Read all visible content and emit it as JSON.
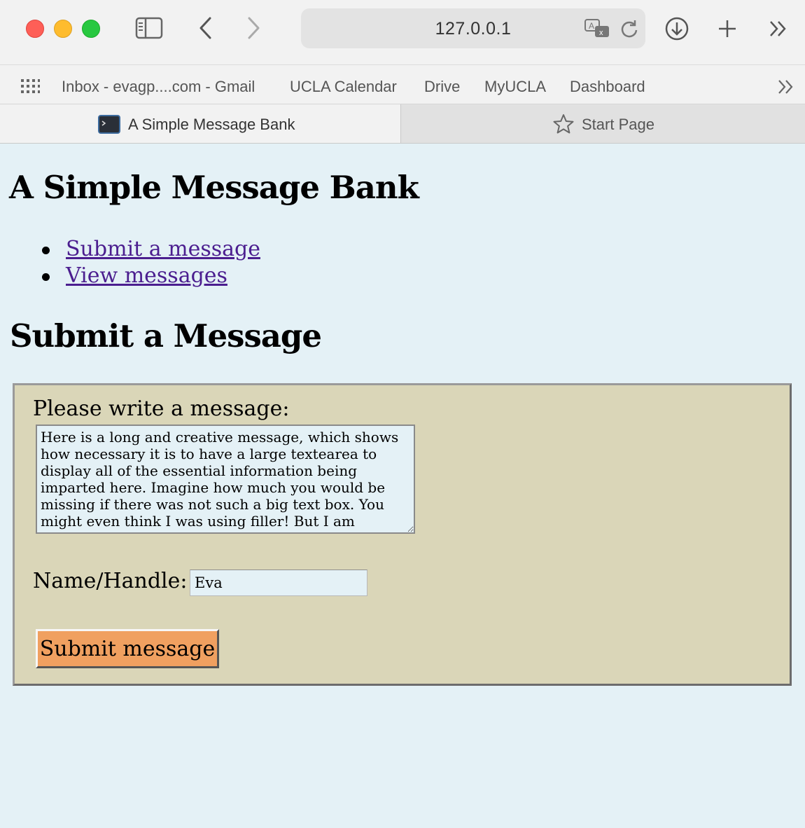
{
  "browser": {
    "address": "127.0.0.1",
    "bookmarks": [
      "Inbox - evagp....com - Gmail",
      "UCLA Calendar",
      "Drive",
      "MyUCLA",
      "Dashboard"
    ],
    "tabs": [
      {
        "label": "A Simple Message Bank",
        "active": true,
        "icon": "terminal-icon"
      },
      {
        "label": "Start Page",
        "active": false,
        "icon": "star-icon"
      }
    ],
    "icons": [
      "sidebar-icon",
      "back-icon",
      "forward-icon",
      "translate-icon",
      "reload-icon",
      "download-icon",
      "new-tab-icon",
      "overflow-icon",
      "grid-icon"
    ]
  },
  "page": {
    "title": "A Simple Message Bank",
    "nav": [
      {
        "label": "Submit a message"
      },
      {
        "label": "View messages"
      }
    ],
    "section_title": "Submit a Message",
    "form": {
      "message_label": "Please write a message:",
      "message_value": "Here is a long and creative message, which shows how necessary it is to have a large textearea to display all of the essential information being imparted here. Imagine how much you would be missing if there was not such a big text box. You might even think I was using filler! But I am definitely not doing that at all.",
      "name_label": "Name/Handle:",
      "name_value": "Eva",
      "submit_label": "Submit message"
    }
  },
  "colors": {
    "page_bg": "#e4f1f6",
    "form_bg": "#dad6b8",
    "button_bg": "#f0a060",
    "link": "#4b1e8f"
  }
}
